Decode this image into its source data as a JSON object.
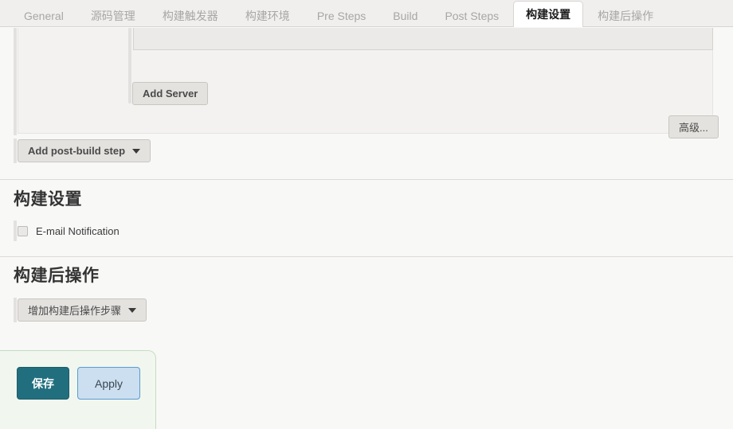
{
  "tabs": [
    {
      "label": "General",
      "active": false
    },
    {
      "label": "源码管理",
      "active": false
    },
    {
      "label": "构建触发器",
      "active": false
    },
    {
      "label": "构建环境",
      "active": false
    },
    {
      "label": "Pre Steps",
      "active": false
    },
    {
      "label": "Build",
      "active": false
    },
    {
      "label": "Post Steps",
      "active": false
    },
    {
      "label": "构建设置",
      "active": true
    },
    {
      "label": "构建后操作",
      "active": false
    }
  ],
  "top_region": {
    "add_server_label": "Add Server",
    "advanced_label": "高级...",
    "add_post_build_step_label": "Add post-build step"
  },
  "build_settings": {
    "heading": "构建设置",
    "email_notification_label": "E-mail Notification",
    "email_notification_checked": false
  },
  "post_build_actions": {
    "heading": "构建后操作",
    "add_step_label": "增加构建后操作步骤"
  },
  "save_bar": {
    "save_label": "保存",
    "apply_label": "Apply"
  },
  "colors": {
    "page_background": "#f8f8f7",
    "tabbar_background": "#f0efee",
    "active_tab_background": "#ffffff",
    "save_button": "#216f7e",
    "apply_button": "#cbdff0",
    "apply_border": "#5b9bd1",
    "savebar_background": "#f1f7ee",
    "savebar_border": "#c7dcc0"
  }
}
